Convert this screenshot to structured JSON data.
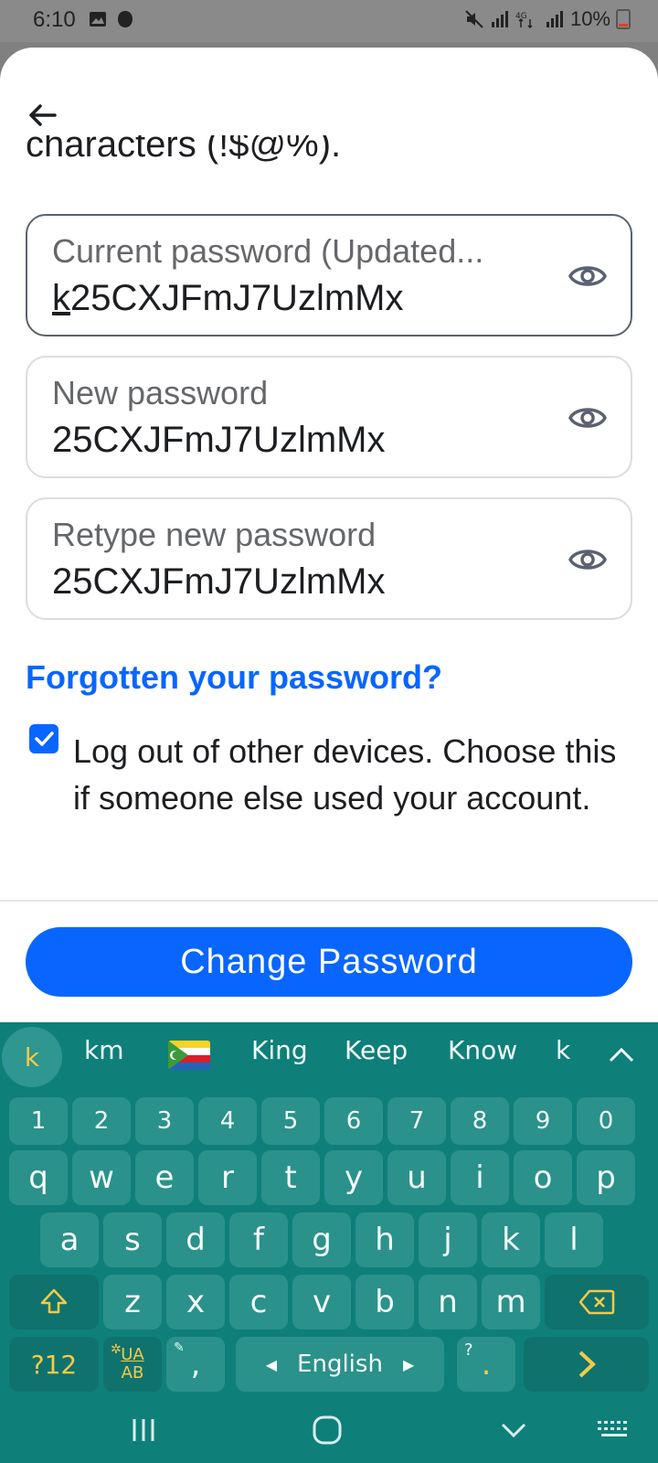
{
  "status_bar": {
    "time": "6:10",
    "battery": "10%"
  },
  "form": {
    "clipped_intro_text": "characters (!$@%).",
    "current_password": {
      "label": "Current password (Updated...",
      "value_first_char": "k",
      "value_rest": "25CXJFmJ7UzlmMx"
    },
    "new_password": {
      "label": "New password",
      "value": "25CXJFmJ7UzlmMx"
    },
    "retype_password": {
      "label": "Retype new password",
      "value": "25CXJFmJ7UzlmMx"
    },
    "forgot_link": "Forgotten your password?",
    "logout_checkbox": {
      "checked": true,
      "label": "Log out of other devices. Choose this if someone else used your account."
    },
    "submit_label": "Change Password"
  },
  "keyboard": {
    "suggestions": [
      "k",
      "km",
      "King",
      "Keep",
      "Know",
      "k"
    ],
    "number_row": [
      "1",
      "2",
      "3",
      "4",
      "5",
      "6",
      "7",
      "8",
      "9",
      "0"
    ],
    "row1": [
      "q",
      "w",
      "e",
      "r",
      "t",
      "y",
      "u",
      "i",
      "o",
      "p"
    ],
    "row2": [
      "a",
      "s",
      "d",
      "f",
      "g",
      "h",
      "j",
      "k",
      "l"
    ],
    "row3": [
      "z",
      "x",
      "c",
      "v",
      "b",
      "n",
      "m"
    ],
    "symbols_key": "?12",
    "lang_switch_top": "UA",
    "lang_switch_bottom": "AB",
    "comma": ",",
    "space_label": "English",
    "period": ".",
    "period_hint": "?",
    "accent_color": "#f7c948",
    "background_color": "#0f7f7a"
  },
  "colors": {
    "brand_blue": "#0866ff"
  }
}
